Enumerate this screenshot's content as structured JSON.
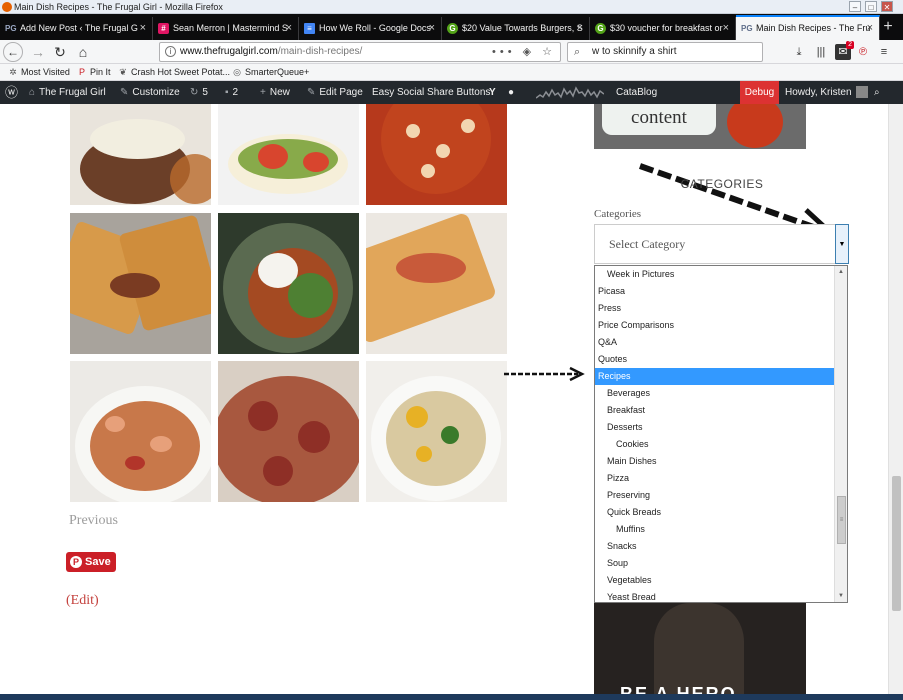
{
  "window": {
    "title": "Main Dish Recipes - The Frugal Girl - Mozilla Firefox",
    "controls": [
      "–",
      "□",
      "✕"
    ]
  },
  "tabs": [
    {
      "label": "Add New Post ‹ The Frugal G",
      "icon": "PG",
      "icon_color": "#5f6e8a",
      "active": false
    },
    {
      "label": "Sean Merron | Mastermind S",
      "icon": "#",
      "icon_color": "#e01563",
      "active": false
    },
    {
      "label": "How We Roll - Google Docs",
      "icon": "≡",
      "icon_color": "#4285f4",
      "active": false
    },
    {
      "label": "$20 Value Towards Burgers, S",
      "icon": "G",
      "icon_color": "#53a318",
      "active": false
    },
    {
      "label": "$30 voucher for breakfast or",
      "icon": "G",
      "icon_color": "#53a318",
      "active": false
    },
    {
      "label": "Main Dish Recipes - The Fru",
      "icon": "PG",
      "icon_color": "#5f6e8a",
      "active": true
    }
  ],
  "nav": {
    "url_host": "www.thefrugalgirl.com",
    "url_path": "/main-dish-recipes/",
    "url_icons": "••• ◈ ☆",
    "search_value": "w to skinnify a shirt",
    "badge_count": "2"
  },
  "bookmarks": [
    {
      "label": "Most Visited",
      "icon": "✲"
    },
    {
      "label": "Pin It",
      "icon": "P"
    },
    {
      "label": "Crash Hot Sweet Potat...",
      "icon": "❦"
    },
    {
      "label": "SmarterQueue+",
      "icon": "◎"
    }
  ],
  "wp_admin": {
    "site_name": "The Frugal Girl",
    "customize": "Customize",
    "updates": "5",
    "comments": "2",
    "new": "New",
    "edit_page": "Edit Page",
    "share_buttons": "Easy Social Share Buttons",
    "catablog": "CataBlog",
    "debug": "Debug",
    "howdy": "Howdy, Kristen"
  },
  "content": {
    "previous_label": "Previous",
    "save_label": "Save",
    "pin_icon_glyph": "P",
    "edit_label": "(Edit)"
  },
  "sidebar": {
    "ad_top_text": "content",
    "heading": "CATEGORIES",
    "label": "Categories",
    "select_placeholder": "Select Category",
    "options": [
      {
        "label": "Week in Pictures",
        "level": 1
      },
      {
        "label": "Picasa",
        "level": 0
      },
      {
        "label": "Press",
        "level": 0
      },
      {
        "label": "Price Comparisons",
        "level": 0
      },
      {
        "label": "Q&A",
        "level": 0
      },
      {
        "label": "Quotes",
        "level": 0
      },
      {
        "label": "Recipes",
        "level": 0,
        "selected": true
      },
      {
        "label": "Beverages",
        "level": 1
      },
      {
        "label": "Breakfast",
        "level": 1
      },
      {
        "label": "Desserts",
        "level": 1
      },
      {
        "label": "Cookies",
        "level": 2
      },
      {
        "label": "Main Dishes",
        "level": 1
      },
      {
        "label": "Pizza",
        "level": 1
      },
      {
        "label": "Preserving",
        "level": 1
      },
      {
        "label": "Quick Breads",
        "level": 1
      },
      {
        "label": "Muffins",
        "level": 2
      },
      {
        "label": "Snacks",
        "level": 1
      },
      {
        "label": "Soup",
        "level": 1
      },
      {
        "label": "Vegetables",
        "level": 1
      },
      {
        "label": "Yeast Bread",
        "level": 1
      }
    ],
    "ad_bottom_text": "BE A HERO"
  },
  "colors": {
    "selected_option": "#3399ff",
    "save_button": "#cb1f27",
    "edit_link": "#c4413d",
    "wp_bar": "#23282d",
    "debug": "#dc3232"
  }
}
